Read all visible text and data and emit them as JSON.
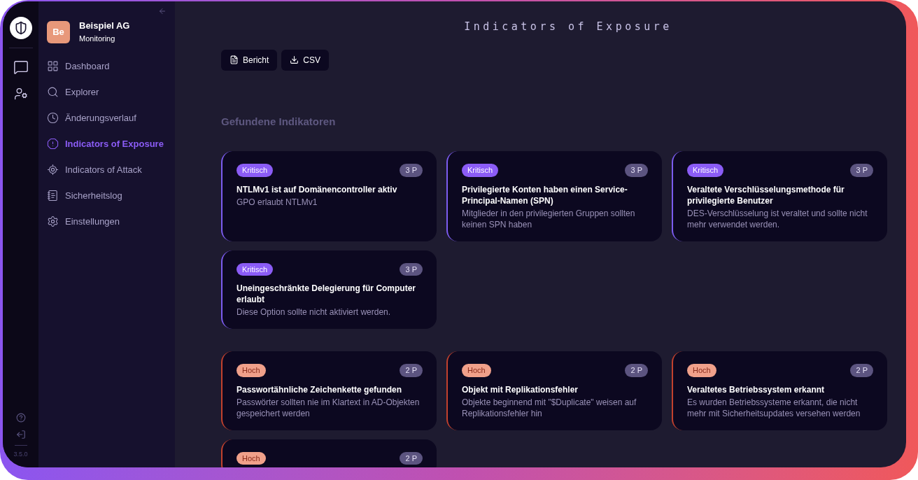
{
  "rail": {
    "version": "3.5.0"
  },
  "sidebar": {
    "org_initials": "Be",
    "org_name": "Beispiel AG",
    "org_subtitle": "Monitoring",
    "items": [
      {
        "label": "Dashboard",
        "selected": false
      },
      {
        "label": "Explorer",
        "selected": false
      },
      {
        "label": "Änderungsverlauf",
        "selected": false
      },
      {
        "label": "Indicators of Exposure",
        "selected": true
      },
      {
        "label": "Indicators of Attack",
        "selected": false
      },
      {
        "label": "Sicherheitslog",
        "selected": false
      },
      {
        "label": "Einstellungen",
        "selected": false
      }
    ]
  },
  "main": {
    "title": "Indicators of Exposure",
    "buttons": [
      {
        "label": "Bericht"
      },
      {
        "label": "CSV"
      }
    ],
    "section_title": "Gefundene Indikatoren",
    "groups": [
      {
        "kind": "critical",
        "cards": [
          {
            "badge": "Kritisch",
            "points": "3 P",
            "title": "NTLMv1 ist auf Domänencontroller aktiv",
            "description": "GPO erlaubt NTLMv1"
          },
          {
            "badge": "Kritisch",
            "points": "3 P",
            "title": "Privilegierte Konten haben einen Service-Principal-Namen (SPN)",
            "description": "Mitglieder in den privilegierten Gruppen sollten keinen SPN haben"
          },
          {
            "badge": "Kritisch",
            "points": "3 P",
            "title": "Veraltete Verschlüsselungsmethode für privilegierte Benutzer",
            "description": "DES-Verschlüsselung ist veraltet und sollte nicht mehr verwendet werden."
          },
          {
            "badge": "Kritisch",
            "points": "3 P",
            "title": "Uneingeschränkte Delegierung für Computer erlaubt",
            "description": "Diese Option sollte nicht aktiviert werden."
          }
        ]
      },
      {
        "kind": "high",
        "cards": [
          {
            "badge": "Hoch",
            "points": "2 P",
            "title": "Passwortähnliche Zeichenkette gefunden",
            "description": "Passwörter sollten nie im Klartext in AD-Objekten gespeichert werden"
          },
          {
            "badge": "Hoch",
            "points": "2 P",
            "title": "Objekt mit Replikationsfehler",
            "description": "Objekte beginnend mit \"$Duplicate\" weisen auf Replikationsfehler hin"
          },
          {
            "badge": "Hoch",
            "points": "2 P",
            "title": "Veraltetes Betriebssystem erkannt",
            "description": "Es wurden Betriebssysteme erkannt, die nicht mehr mit Sicherheitsupdates versehen werden"
          },
          {
            "badge": "Hoch",
            "points": "2 P"
          }
        ]
      }
    ]
  }
}
